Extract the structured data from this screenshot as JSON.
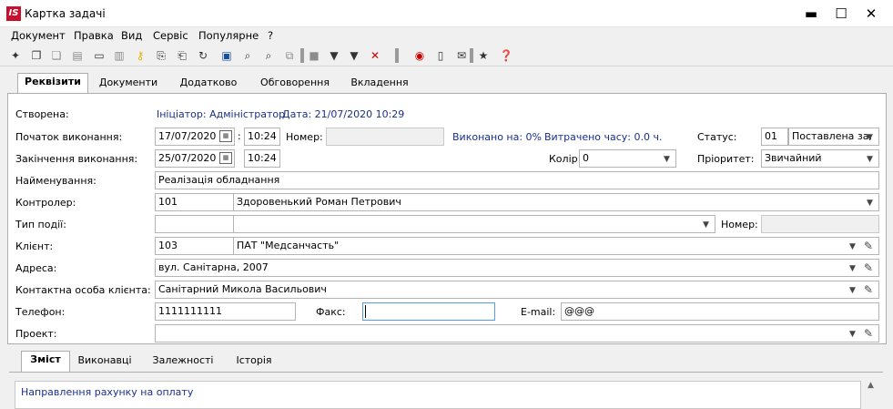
{
  "window": {
    "logo_text": "IS",
    "title": "Картка задачі",
    "minimize": "▬",
    "maximize": "☐",
    "close": "✕"
  },
  "menu": [
    "Документ",
    "Правка",
    "Вид",
    "Сервіс",
    "Популярне",
    "?"
  ],
  "toolbar_icons": [
    "new-doc-icon",
    "new-copy-icon",
    "copy-icon",
    "paste-icon",
    "print-icon",
    "key-icon",
    "export-icon",
    "import-icon",
    "refresh-icon",
    "save-icon",
    "search-icon",
    "search-next-icon",
    "duplicate-icon",
    "grid-icon",
    "filter-icon",
    "filter-add-icon",
    "filter-clear-icon",
    "record-icon",
    "document-icon",
    "mail-icon",
    "star-icon",
    "help-icon"
  ],
  "tabs": [
    "Реквізити",
    "Документи",
    "Додатково",
    "Обговорення",
    "Вкладення"
  ],
  "form": {
    "created_label": "Створена:",
    "initiator": "Ініціатор: Адміністратор",
    "date": "Дата: 21/07/2020  10:29",
    "start_label": "Початок виконання:",
    "start_date": "17/07/2020",
    "time_sep": ":",
    "start_time": "10:24",
    "number_label": "Номер:",
    "number_value": "",
    "done_percent": "Виконано на: 0%",
    "time_spent": "Витрачено часу: 0.0 ч.",
    "status_label": "Статус:",
    "status_code": "01",
    "status_value": "Поставлена за,",
    "end_label": "Закінчення виконання:",
    "end_date": "25/07/2020",
    "end_time": "10:24",
    "color_label": "Колір:",
    "color_value": "0",
    "priority_label": "Пріоритет:",
    "priority_value": "Звичайний",
    "name_label": "Найменування:",
    "name_value": "Реалізація обладнання",
    "controller_label": "Контролер:",
    "controller_code": "101",
    "controller_name": "Здоровенький Роман Петрович",
    "event_type_label": "Тип події:",
    "event_code": "",
    "event_name": "",
    "event_number_label": "Номер:",
    "event_number": "",
    "client_label": "Клієнт:",
    "client_code": "103",
    "client_name": "ПАТ \"Медсанчасть\"",
    "address_label": "Адреса:",
    "address_value": "вул. Санітарна, 2007",
    "contact_label": "Контактна особа клієнта:",
    "contact_value": "Санітарний Микола Васильович",
    "phone_label": "Телефон:",
    "phone_value": "1111111111",
    "fax_label": "Факс:",
    "fax_value": "",
    "email_label": "E-mail:",
    "email_value": "@@@",
    "project_label": "Проект:",
    "project_value": ""
  },
  "bottom_tabs": [
    "Зміст",
    "Виконавці",
    "Залежності",
    "Історія"
  ],
  "content_text": "Направлення рахунку на оплату",
  "glyphs": {
    "dropdown": "▼",
    "pencil": "✎",
    "calendar": "▦",
    "scroll_up": "▲"
  }
}
